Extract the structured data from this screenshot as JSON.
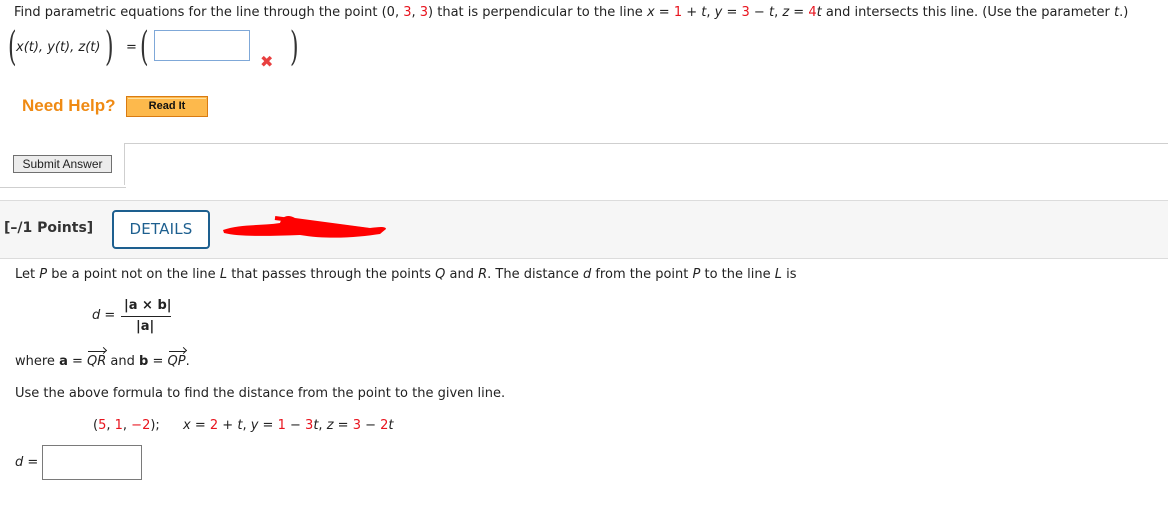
{
  "question1": {
    "prompt_parts": [
      {
        "text": "Find parametric equations for the line through the point (",
        "style": "normal"
      },
      {
        "text": "0",
        "style": "normal"
      },
      {
        "text": ", ",
        "style": "normal"
      },
      {
        "text": "3",
        "style": "red"
      },
      {
        "text": ", ",
        "style": "normal"
      },
      {
        "text": "3",
        "style": "red"
      },
      {
        "text": ") that is perpendicular to the line ",
        "style": "normal"
      },
      {
        "text": "x",
        "style": "italic"
      },
      {
        "text": " = ",
        "style": "normal"
      },
      {
        "text": "1",
        "style": "red"
      },
      {
        "text": " + ",
        "style": "normal"
      },
      {
        "text": "t",
        "style": "italic"
      },
      {
        "text": ", ",
        "style": "normal"
      },
      {
        "text": "y",
        "style": "italic"
      },
      {
        "text": " = ",
        "style": "normal"
      },
      {
        "text": "3",
        "style": "red"
      },
      {
        "text": " − ",
        "style": "normal"
      },
      {
        "text": "t",
        "style": "italic"
      },
      {
        "text": ", ",
        "style": "normal"
      },
      {
        "text": "z",
        "style": "italic"
      },
      {
        "text": " = ",
        "style": "normal"
      },
      {
        "text": "4",
        "style": "red"
      },
      {
        "text": "t",
        "style": "italic"
      },
      {
        "text": " and intersects this line. (Use the parameter ",
        "style": "normal"
      },
      {
        "text": "t",
        "style": "italic"
      },
      {
        "text": ".)",
        "style": "normal"
      }
    ],
    "lhs": "x(t), y(t), z(t)",
    "equals": "=",
    "answer_value": "",
    "status_icon": "incorrect-x-icon",
    "status_symbol": "✖",
    "need_help_label": "Need Help?",
    "read_it_label": "Read It",
    "submit_label": "Submit Answer"
  },
  "question2": {
    "points_label": "[–/1 Points]",
    "details_label": "DETAILS",
    "intro_parts": [
      {
        "text": "Let ",
        "style": "normal"
      },
      {
        "text": "P",
        "style": "italic"
      },
      {
        "text": " be a point not on the line ",
        "style": "normal"
      },
      {
        "text": "L",
        "style": "italic"
      },
      {
        "text": " that passes through the points ",
        "style": "normal"
      },
      {
        "text": "Q",
        "style": "italic"
      },
      {
        "text": " and ",
        "style": "normal"
      },
      {
        "text": "R",
        "style": "italic"
      },
      {
        "text": ". The distance ",
        "style": "normal"
      },
      {
        "text": "d",
        "style": "italic"
      },
      {
        "text": " from the point ",
        "style": "normal"
      },
      {
        "text": "P",
        "style": "italic"
      },
      {
        "text": " to the line ",
        "style": "normal"
      },
      {
        "text": "L",
        "style": "italic"
      },
      {
        "text": " is",
        "style": "normal"
      }
    ],
    "formula": {
      "lhs_var": "d",
      "equals": "=",
      "numerator": "|a × b|",
      "denominator": "|a|"
    },
    "where": {
      "prefix": "where ",
      "a": "a",
      "eq1": " = ",
      "vec_a": "QR",
      "mid": " and ",
      "b": "b",
      "eq2": " = ",
      "vec_b": "QP",
      "suffix": "."
    },
    "instruction": "Use the above formula to find the distance from the point to the given line.",
    "point_parts": [
      {
        "text": "(",
        "style": "normal"
      },
      {
        "text": "5",
        "style": "red"
      },
      {
        "text": ", ",
        "style": "normal"
      },
      {
        "text": "1",
        "style": "red"
      },
      {
        "text": ", ",
        "style": "normal"
      },
      {
        "text": "−2",
        "style": "red"
      },
      {
        "text": ");",
        "style": "normal"
      }
    ],
    "line_parts": [
      {
        "text": "x",
        "style": "italic"
      },
      {
        "text": " = ",
        "style": "normal"
      },
      {
        "text": "2",
        "style": "red"
      },
      {
        "text": " + ",
        "style": "normal"
      },
      {
        "text": "t",
        "style": "italic"
      },
      {
        "text": ", ",
        "style": "normal"
      },
      {
        "text": "y",
        "style": "italic"
      },
      {
        "text": " = ",
        "style": "normal"
      },
      {
        "text": "1",
        "style": "red"
      },
      {
        "text": " − ",
        "style": "normal"
      },
      {
        "text": "3",
        "style": "red"
      },
      {
        "text": "t",
        "style": "italic"
      },
      {
        "text": ", ",
        "style": "normal"
      },
      {
        "text": "z",
        "style": "italic"
      },
      {
        "text": " = ",
        "style": "normal"
      },
      {
        "text": "3",
        "style": "red"
      },
      {
        "text": " − ",
        "style": "normal"
      },
      {
        "text": "2",
        "style": "red"
      },
      {
        "text": "t",
        "style": "italic"
      }
    ],
    "answer_label_var": "d",
    "answer_label_eq": " =",
    "answer_value": ""
  },
  "colors": {
    "value_red": "#e8141e",
    "help_orange": "#ef8a13",
    "read_it_bg": "#fdb94c",
    "details_blue": "#1d5f8f",
    "header_bar_bg": "#f6f6f6",
    "redaction": "#ff0000"
  }
}
